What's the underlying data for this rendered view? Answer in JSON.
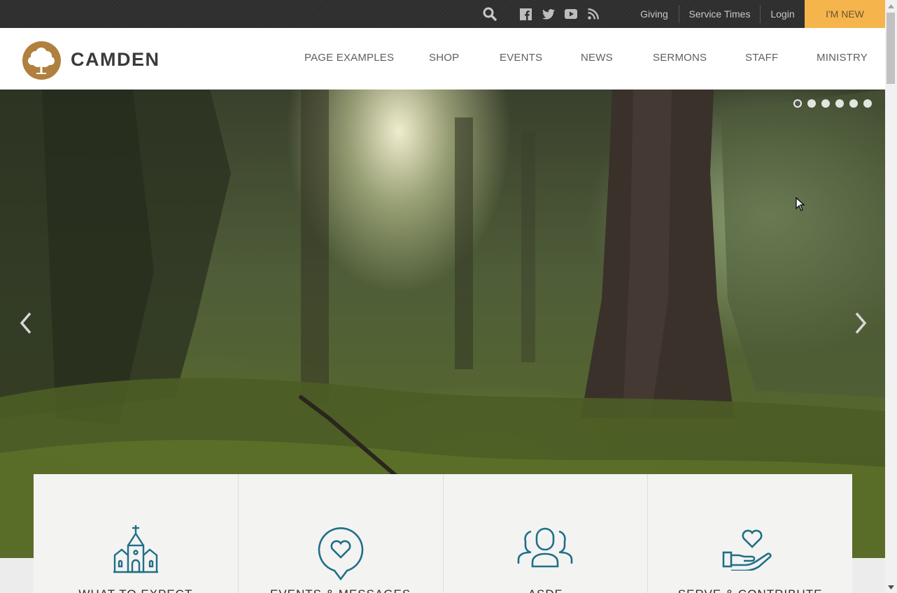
{
  "topbar": {
    "icons": [
      "search-icon",
      "facebook-icon",
      "twitter-icon",
      "youtube-icon",
      "rss-icon"
    ],
    "links": {
      "giving": "Giving",
      "service_times": "Service Times",
      "login": "Login"
    },
    "cta": "I'M NEW",
    "cta_color": "#f5b54c"
  },
  "header": {
    "brand": "CAMDEN",
    "logo_color": "#b0803f",
    "nav": {
      "page_examples": "PAGE EXAMPLES",
      "shop": "SHOP",
      "events": "EVENTS",
      "news": "NEWS",
      "sermons": "SERMONS",
      "staff": "STAFF",
      "ministry": "MINISTRY"
    }
  },
  "slider": {
    "slide_count": 6,
    "active_slide": 1,
    "prev_icon": "chevron-left-icon",
    "next_icon": "chevron-right-icon"
  },
  "cards": {
    "accent_color": "#1f6f86",
    "items": [
      {
        "title": "WHAT TO EXPECT",
        "icon": "church-icon"
      },
      {
        "title": "EVENTS & MESSAGES",
        "icon": "heart-bubble-icon"
      },
      {
        "title": "ASDF",
        "icon": "people-icon"
      },
      {
        "title": "SERVE & CONTRIBUTE",
        "icon": "hand-heart-icon"
      }
    ]
  }
}
